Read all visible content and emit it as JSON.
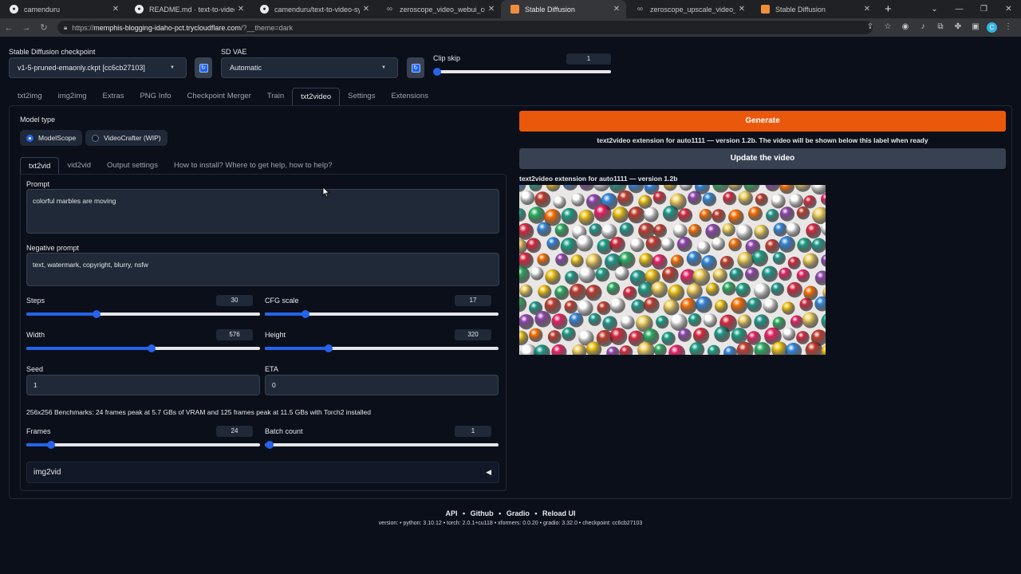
{
  "browser": {
    "tabs": [
      {
        "title": "camenduru",
        "icon": "github-icon"
      },
      {
        "title": "README.md · text-to-video-synth",
        "icon": "github-icon"
      },
      {
        "title": "camenduru/text-to-video-synth",
        "icon": "github-icon"
      },
      {
        "title": "zeroscope_video_webui_colab.ip",
        "icon": "link-icon"
      },
      {
        "title": "Stable Diffusion",
        "icon": "sd-icon"
      },
      {
        "title": "zeroscope_upscale_video_webui",
        "icon": "link-icon"
      },
      {
        "title": "Stable Diffusion",
        "icon": "sd-icon"
      }
    ],
    "url_prefix": "https://",
    "url_host": "memphis-blogging-idaho-pct.trycloudflare.com",
    "url_path": "/?__theme=dark",
    "profile_letter": "C"
  },
  "top": {
    "checkpoint_label": "Stable Diffusion checkpoint",
    "checkpoint_value": "v1-5-pruned-emaonly.ckpt [cc6cb27103]",
    "vae_label": "SD VAE",
    "vae_value": "Automatic",
    "clip_label": "Clip skip",
    "clip_value": "1"
  },
  "main_tabs": [
    "txt2img",
    "img2img",
    "Extras",
    "PNG Info",
    "Checkpoint Merger",
    "Train",
    "txt2video",
    "Settings",
    "Extensions"
  ],
  "model_type": {
    "label": "Model type",
    "options": [
      "ModelScope",
      "VideoCrafter (WIP)"
    ]
  },
  "sub_tabs": [
    "txt2vid",
    "vid2vid",
    "Output settings",
    "How to install? Where to get help, how to help?"
  ],
  "prompt": {
    "label": "Prompt",
    "value": "colorful marbles are moving"
  },
  "negative_prompt": {
    "label": "Negative prompt",
    "value": "text, watermark, copyright, blurry, nsfw"
  },
  "sliders": {
    "steps": {
      "label": "Steps",
      "value": "30"
    },
    "cfg": {
      "label": "CFG scale",
      "value": "17"
    },
    "width": {
      "label": "Width",
      "value": "576"
    },
    "height": {
      "label": "Height",
      "value": "320"
    },
    "frames": {
      "label": "Frames",
      "value": "24"
    },
    "batch": {
      "label": "Batch count",
      "value": "1"
    }
  },
  "seed": {
    "label": "Seed",
    "value": "1"
  },
  "eta": {
    "label": "ETA",
    "value": "0"
  },
  "benchmarks": "256x256 Benchmarks: 24 frames peak at 5.7 GBs of VRAM and 125 frames peak at 11.5 GBs with Torch2 installed",
  "img2vid_label": "img2vid",
  "right": {
    "generate": "Generate",
    "status": "text2video extension for auto1111 — version 1.2b. The video will be shown below this label when ready",
    "update": "Update the video",
    "video_label": "text2video extension for auto1111 — version 1.2b"
  },
  "footer": {
    "links": [
      "API",
      "Github",
      "Gradio",
      "Reload UI"
    ],
    "version": "version:  •  python: 3.10.12  •  torch: 2.0.1+cu118  •  xformers: 0.0.20  •  gradio: 3.32.0  •  checkpoint: cc6cb27103"
  },
  "colors": {
    "accent": "#2563eb",
    "generate": "#ea580c",
    "background": "#0b0f19"
  }
}
